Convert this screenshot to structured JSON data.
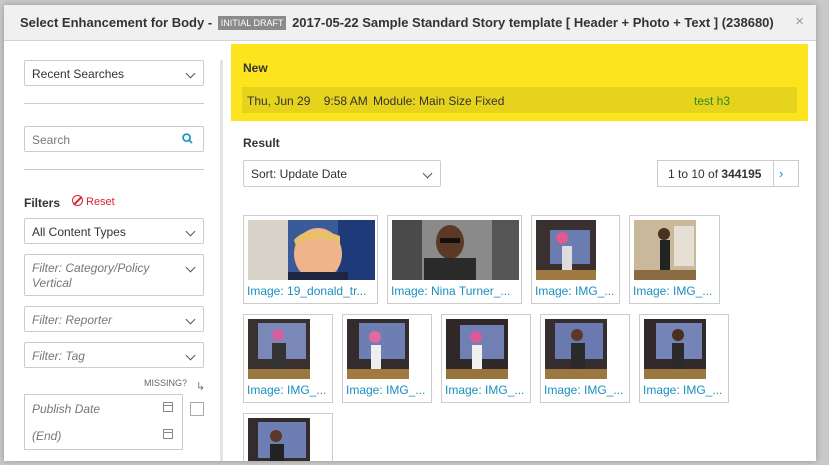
{
  "header": {
    "title_prefix": "Select Enhancement for Body -",
    "badge": "INITIAL DRAFT",
    "title_suffix": "2017-05-22 Sample Standard Story template [ Header + Photo + Text ] (238680)",
    "close": "×"
  },
  "sidebar": {
    "recent_searches": "Recent Searches",
    "search_placeholder": "Search",
    "filters_label": "Filters",
    "reset_label": "Reset",
    "content_type": "All Content Types",
    "filter_category": "Filter: Category/Policy Vertical",
    "filter_reporter": "Filter: Reporter",
    "filter_tag": "Filter: Tag",
    "missing_label": "MISSING?",
    "publish_date_placeholder": "Publish Date",
    "end_placeholder": "(End)"
  },
  "new_panel": {
    "title": "New",
    "row_date": "Thu, Jun 29    9:58 AM",
    "row_module": "Module: Main Size Fixed",
    "row_user": "test h3"
  },
  "result": {
    "label": "Result",
    "sort": "Sort: Update Date",
    "pager_range": "1 to 10 of",
    "pager_total": "344195",
    "next": "›",
    "thumbnails": [
      "Image: 19_donald_tr...",
      "Image: Nina Turner_...",
      "Image: IMG_...",
      "Image: IMG_...",
      "Image: IMG_...",
      "Image: IMG_...",
      "Image: IMG_...",
      "Image: IMG_...",
      "Image: IMG_...",
      ""
    ]
  }
}
